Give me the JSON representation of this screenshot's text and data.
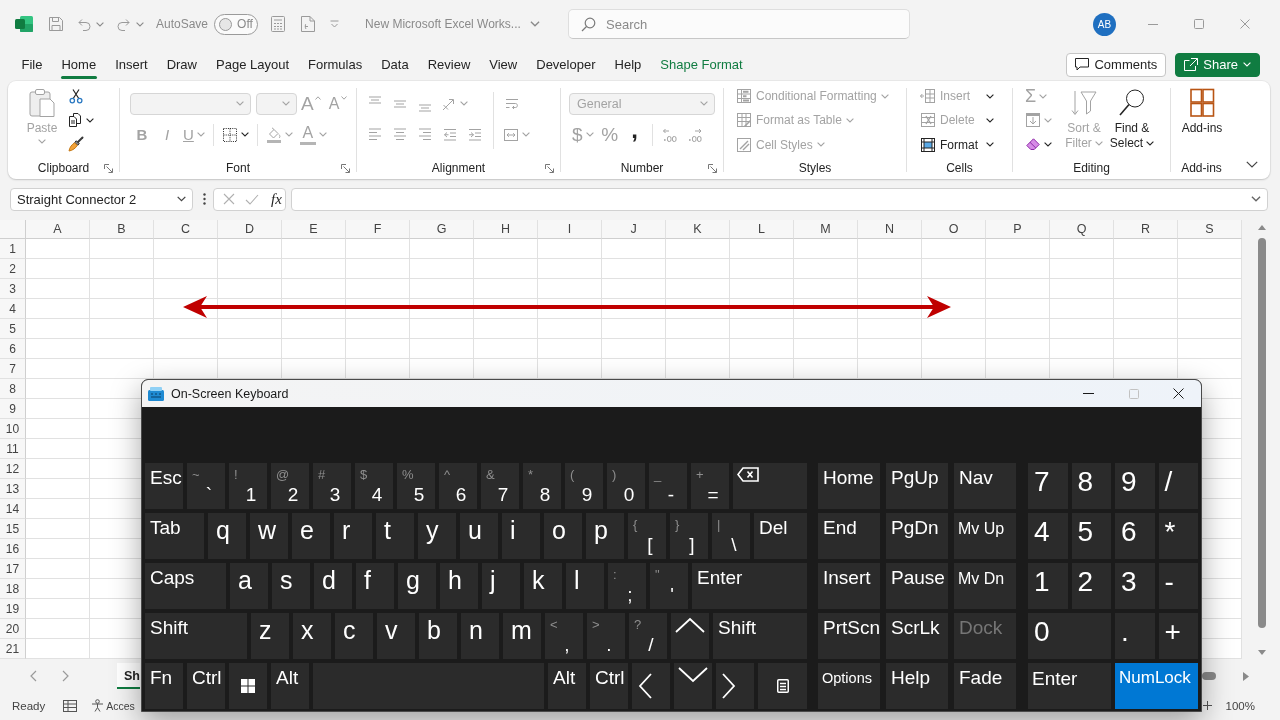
{
  "title_bar": {
    "autosave": {
      "label": "AutoSave",
      "state": "Off",
      "on": false
    },
    "document_title": "New Microsoft Excel Works...",
    "search": {
      "placeholder": "Search"
    },
    "account": {
      "initials": "AB"
    }
  },
  "ribbon_tabs": [
    {
      "label": "File",
      "kind": "standard",
      "selected": false
    },
    {
      "label": "Home",
      "kind": "standard",
      "selected": true
    },
    {
      "label": "Insert",
      "kind": "standard",
      "selected": false
    },
    {
      "label": "Draw",
      "kind": "standard",
      "selected": false
    },
    {
      "label": "Page Layout",
      "kind": "standard",
      "selected": false
    },
    {
      "label": "Formulas",
      "kind": "standard",
      "selected": false
    },
    {
      "label": "Data",
      "kind": "standard",
      "selected": false
    },
    {
      "label": "Review",
      "kind": "standard",
      "selected": false
    },
    {
      "label": "View",
      "kind": "standard",
      "selected": false
    },
    {
      "label": "Developer",
      "kind": "standard",
      "selected": false
    },
    {
      "label": "Help",
      "kind": "standard",
      "selected": false
    },
    {
      "label": "Shape Format",
      "kind": "contextual",
      "selected": false
    }
  ],
  "header_buttons": [
    {
      "kind": "outline",
      "label": "Comments"
    },
    {
      "kind": "primary",
      "label": "Share"
    }
  ],
  "ribbon": {
    "clipboard": {
      "label": "Clipboard",
      "launcher": true,
      "paste": {
        "label": "Paste",
        "disabled": true
      },
      "tools": [
        {
          "kind": "cut",
          "disabled": false,
          "dropdown": false
        },
        {
          "kind": "copy",
          "disabled": false,
          "dropdown": true
        },
        {
          "kind": "format-painter",
          "disabled": false,
          "dropdown": false
        }
      ]
    },
    "font": {
      "label": "Font",
      "launcher": true,
      "font_name": {
        "disabled": true
      },
      "font_size": {
        "disabled": true
      },
      "size_tools": [
        {
          "kind": "grow-font",
          "glyph": "A",
          "disabled": true,
          "dropdown": false
        },
        {
          "kind": "shrink-font",
          "glyph": "A",
          "disabled": true,
          "dropdown": false
        }
      ],
      "format_tools": [
        {
          "kind": "bold",
          "glyph": "B",
          "disabled": true,
          "dropdown": false
        },
        {
          "kind": "italic",
          "glyph": "I",
          "disabled": true,
          "dropdown": false
        },
        {
          "kind": "underline",
          "glyph": "U",
          "disabled": true,
          "dropdown": true
        },
        {
          "kind": "borders",
          "disabled": false,
          "dropdown": true
        },
        {
          "kind": "fill-color",
          "disabled": true,
          "dropdown": true
        },
        {
          "kind": "font-color",
          "glyph": "A",
          "disabled": true,
          "dropdown": true
        }
      ]
    },
    "alignment": {
      "label": "Alignment",
      "launcher": true,
      "vertical_tools": [
        {
          "kind": "align-top",
          "disabled": true,
          "dropdown": false
        },
        {
          "kind": "align-middle",
          "disabled": true,
          "dropdown": false
        },
        {
          "kind": "align-bottom",
          "disabled": true,
          "dropdown": false
        },
        {
          "kind": "orientation",
          "disabled": true,
          "dropdown": true
        }
      ],
      "horizontal_tools": [
        {
          "kind": "align-left",
          "disabled": true,
          "dropdown": false
        },
        {
          "kind": "align-center",
          "disabled": true,
          "dropdown": false
        },
        {
          "kind": "align-right",
          "disabled": true,
          "dropdown": false
        },
        {
          "kind": "indent-decrease",
          "disabled": true,
          "dropdown": false
        },
        {
          "kind": "indent-increase",
          "disabled": true,
          "dropdown": false
        }
      ],
      "wrap_tools": [
        {
          "kind": "wrap-text",
          "disabled": true,
          "dropdown": false
        },
        {
          "kind": "merge-center",
          "disabled": true,
          "dropdown": true
        }
      ]
    },
    "number": {
      "label": "Number",
      "launcher": true,
      "format": {
        "value": "General",
        "disabled": true
      },
      "tools": [
        {
          "kind": "currency",
          "glyph": "$",
          "disabled": true,
          "dropdown": true
        },
        {
          "kind": "percent",
          "glyph": "%",
          "disabled": true,
          "dropdown": false
        },
        {
          "kind": "comma",
          "glyph": ",",
          "disabled": false,
          "dropdown": false
        },
        {
          "kind": "decimal-increase",
          "disabled": true,
          "dropdown": false
        },
        {
          "kind": "decimal-decrease",
          "disabled": true,
          "dropdown": false
        }
      ]
    },
    "styles": {
      "label": "Styles",
      "launcher": false,
      "items": [
        {
          "kind": "conditional-formatting",
          "label": "Conditional Formatting",
          "disabled": true
        },
        {
          "kind": "format-as-table",
          "label": "Format as Table",
          "disabled": true
        },
        {
          "kind": "cell-styles",
          "label": "Cell Styles",
          "disabled": true
        }
      ]
    },
    "cells": {
      "label": "Cells",
      "launcher": false,
      "items": [
        {
          "kind": "insert-cells",
          "label": "Insert",
          "disabled": true
        },
        {
          "kind": "delete-cells",
          "label": "Delete",
          "disabled": true
        },
        {
          "kind": "format-cells",
          "label": "Format",
          "disabled": false
        }
      ]
    },
    "editing": {
      "label": "Editing",
      "launcher": false,
      "tools": [
        {
          "kind": "autosum",
          "glyph": "Σ",
          "disabled": true,
          "dropdown": true
        },
        {
          "kind": "fill-down",
          "disabled": true,
          "dropdown": true
        },
        {
          "kind": "clear",
          "disabled": false,
          "dropdown": true
        }
      ],
      "large_buttons": [
        {
          "kind": "sort-filter",
          "label": "Sort & Filter",
          "disabled": true
        },
        {
          "kind": "find-select",
          "label": "Find & Select",
          "disabled": false
        }
      ]
    },
    "add_ins": {
      "label": "Add-ins",
      "launcher": false,
      "button": {
        "label": "Add-ins",
        "disabled": false
      }
    }
  },
  "formula_bar": {
    "name_box": "Straight Connector 2",
    "function_label": "fx"
  },
  "sheet": {
    "columns": [
      "A",
      "B",
      "C",
      "D",
      "E",
      "F",
      "G",
      "H",
      "I",
      "J",
      "K",
      "L",
      "M",
      "N",
      "O",
      "P",
      "Q",
      "R",
      "S"
    ],
    "rows": [
      "1",
      "2",
      "3",
      "4",
      "5",
      "6",
      "7",
      "8",
      "9",
      "10",
      "11",
      "12",
      "13",
      "14",
      "15",
      "16",
      "17",
      "18",
      "19",
      "20",
      "21"
    ],
    "shapes": [
      {
        "kind": "double-arrow"
      }
    ]
  },
  "sheet_tabs": [
    {
      "label": "Sh",
      "selected": true
    }
  ],
  "status_bar": {
    "mode": "Ready",
    "accessibility": "Acces",
    "zoom": "100%"
  },
  "on_screen_keyboard": {
    "title": "On-Screen Keyboard",
    "maximize": {
      "disabled": true
    },
    "main_rows": [
      [
        {
          "kind": "char",
          "label": "Esc"
        },
        {
          "kind": "dual",
          "shift": "~",
          "label": "`"
        },
        {
          "kind": "dual",
          "shift": "!",
          "label": "1"
        },
        {
          "kind": "dual",
          "shift": "@",
          "label": "2"
        },
        {
          "kind": "dual",
          "shift": "#",
          "label": "3"
        },
        {
          "kind": "dual",
          "shift": "$",
          "label": "4"
        },
        {
          "kind": "dual",
          "shift": "%",
          "label": "5"
        },
        {
          "kind": "dual",
          "shift": "^",
          "label": "6"
        },
        {
          "kind": "dual",
          "shift": "&",
          "label": "7"
        },
        {
          "kind": "dual",
          "shift": "*",
          "label": "8"
        },
        {
          "kind": "dual",
          "shift": "(",
          "label": "9"
        },
        {
          "kind": "dual",
          "shift": ")",
          "label": "0"
        },
        {
          "kind": "dual",
          "shift": "_",
          "label": "-"
        },
        {
          "kind": "dual",
          "shift": "+",
          "label": "="
        },
        {
          "kind": "backspace"
        }
      ],
      [
        {
          "kind": "char",
          "label": "Tab"
        },
        {
          "kind": "char",
          "label": "q"
        },
        {
          "kind": "char",
          "label": "w"
        },
        {
          "kind": "char",
          "label": "e"
        },
        {
          "kind": "char",
          "label": "r"
        },
        {
          "kind": "char",
          "label": "t"
        },
        {
          "kind": "char",
          "label": "y"
        },
        {
          "kind": "char",
          "label": "u"
        },
        {
          "kind": "char",
          "label": "i"
        },
        {
          "kind": "char",
          "label": "o"
        },
        {
          "kind": "char",
          "label": "p"
        },
        {
          "kind": "dual",
          "shift": "{",
          "label": "["
        },
        {
          "kind": "dual",
          "shift": "}",
          "label": "]"
        },
        {
          "kind": "dual",
          "shift": "|",
          "label": "\\"
        },
        {
          "kind": "char",
          "label": "Del"
        }
      ],
      [
        {
          "kind": "char",
          "label": "Caps"
        },
        {
          "kind": "char",
          "label": "a"
        },
        {
          "kind": "char",
          "label": "s"
        },
        {
          "kind": "char",
          "label": "d"
        },
        {
          "kind": "char",
          "label": "f"
        },
        {
          "kind": "char",
          "label": "g"
        },
        {
          "kind": "char",
          "label": "h"
        },
        {
          "kind": "char",
          "label": "j"
        },
        {
          "kind": "char",
          "label": "k"
        },
        {
          "kind": "char",
          "label": "l"
        },
        {
          "kind": "dual",
          "shift": ":",
          "label": ";"
        },
        {
          "kind": "dual",
          "shift": "\"",
          "label": "'"
        },
        {
          "kind": "char",
          "label": "Enter"
        }
      ],
      [
        {
          "kind": "char",
          "label": "Shift"
        },
        {
          "kind": "char",
          "label": "z"
        },
        {
          "kind": "char",
          "label": "x"
        },
        {
          "kind": "char",
          "label": "c"
        },
        {
          "kind": "char",
          "label": "v"
        },
        {
          "kind": "char",
          "label": "b"
        },
        {
          "kind": "char",
          "label": "n"
        },
        {
          "kind": "char",
          "label": "m"
        },
        {
          "kind": "dual",
          "shift": "<",
          "label": ","
        },
        {
          "kind": "dual",
          "shift": ">",
          "label": "."
        },
        {
          "kind": "dual",
          "shift": "?",
          "label": "/"
        },
        {
          "kind": "arrow-up"
        },
        {
          "kind": "char",
          "label": "Shift"
        }
      ],
      [
        {
          "kind": "char",
          "label": "Fn"
        },
        {
          "kind": "char",
          "label": "Ctrl"
        },
        {
          "kind": "windows"
        },
        {
          "kind": "char",
          "label": "Alt"
        },
        {
          "kind": "space"
        },
        {
          "kind": "char",
          "label": "Alt"
        },
        {
          "kind": "char",
          "label": "Ctrl"
        },
        {
          "kind": "arrow-left"
        },
        {
          "kind": "arrow-down"
        },
        {
          "kind": "arrow-right"
        },
        {
          "kind": "menu"
        }
      ]
    ],
    "nav_rows": [
      [
        {
          "label": "Home",
          "disabled": false
        },
        {
          "label": "PgUp",
          "disabled": false
        },
        {
          "label": "Nav",
          "disabled": false
        }
      ],
      [
        {
          "label": "End",
          "disabled": false
        },
        {
          "label": "PgDn",
          "disabled": false
        },
        {
          "label": "Mv Up",
          "disabled": false
        }
      ],
      [
        {
          "label": "Insert",
          "disabled": false
        },
        {
          "label": "Pause",
          "disabled": false
        },
        {
          "label": "Mv Dn",
          "disabled": false
        }
      ],
      [
        {
          "label": "PrtScn",
          "disabled": false
        },
        {
          "label": "ScrLk",
          "disabled": false
        },
        {
          "label": "Dock",
          "disabled": true
        }
      ],
      [
        {
          "label": "Options",
          "disabled": false
        },
        {
          "label": "Help",
          "disabled": false
        },
        {
          "label": "Fade",
          "disabled": false
        }
      ]
    ],
    "numpad_rows": [
      [
        {
          "label": "7",
          "on": false
        },
        {
          "label": "8",
          "on": false
        },
        {
          "label": "9",
          "on": false
        },
        {
          "label": "/",
          "on": false
        }
      ],
      [
        {
          "label": "4",
          "on": false
        },
        {
          "label": "5",
          "on": false
        },
        {
          "label": "6",
          "on": false
        },
        {
          "label": "*",
          "on": false
        }
      ],
      [
        {
          "label": "1",
          "on": false
        },
        {
          "label": "2",
          "on": false
        },
        {
          "label": "3",
          "on": false
        },
        {
          "label": "-",
          "on": false
        }
      ],
      [
        {
          "label": "0",
          "on": false
        },
        {
          "label": ".",
          "on": false
        },
        {
          "label": "+",
          "on": false
        }
      ],
      [
        {
          "label": "Enter",
          "on": false
        },
        {
          "label": "NumLock",
          "on": true
        }
      ]
    ]
  }
}
